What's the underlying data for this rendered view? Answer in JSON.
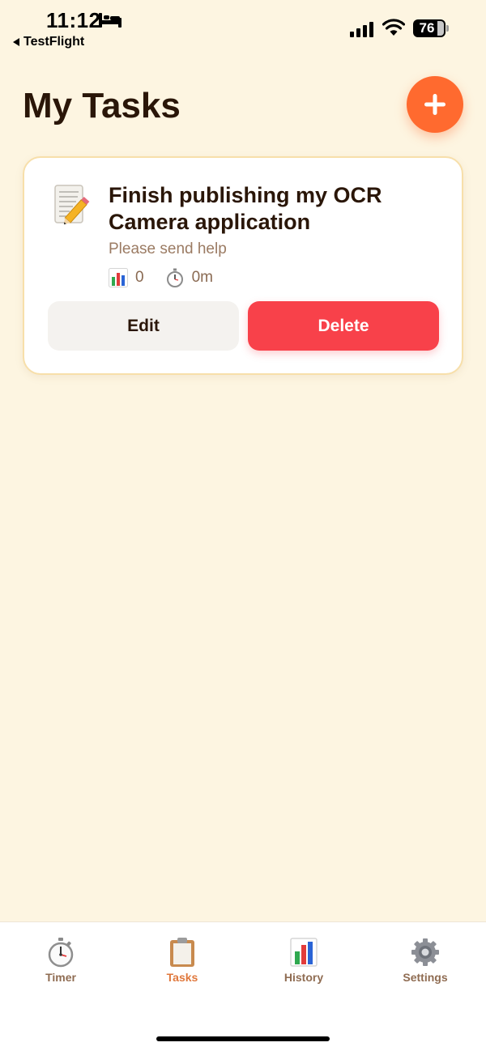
{
  "status_bar": {
    "time": "11:12",
    "back_label": "TestFlight",
    "battery_level": "76"
  },
  "header": {
    "title": "My Tasks"
  },
  "tasks": [
    {
      "icon": "memo-pencil-icon",
      "title": "Finish publishing my OCR Camera application",
      "description": "Please send help",
      "sessions": "0",
      "time_spent": "0m",
      "edit_label": "Edit",
      "delete_label": "Delete"
    }
  ],
  "tab_bar": {
    "active": "Tasks",
    "items": [
      {
        "label": "Timer",
        "icon": "stopwatch-icon"
      },
      {
        "label": "Tasks",
        "icon": "clipboard-icon"
      },
      {
        "label": "History",
        "icon": "bar-chart-icon"
      },
      {
        "label": "Settings",
        "icon": "gear-icon"
      }
    ]
  },
  "colors": {
    "background": "#FDF5E1",
    "accent": "#FF6A2F",
    "delete": "#F8414A",
    "card_border": "#F7DFAA",
    "active_tab": "#E0783C"
  }
}
